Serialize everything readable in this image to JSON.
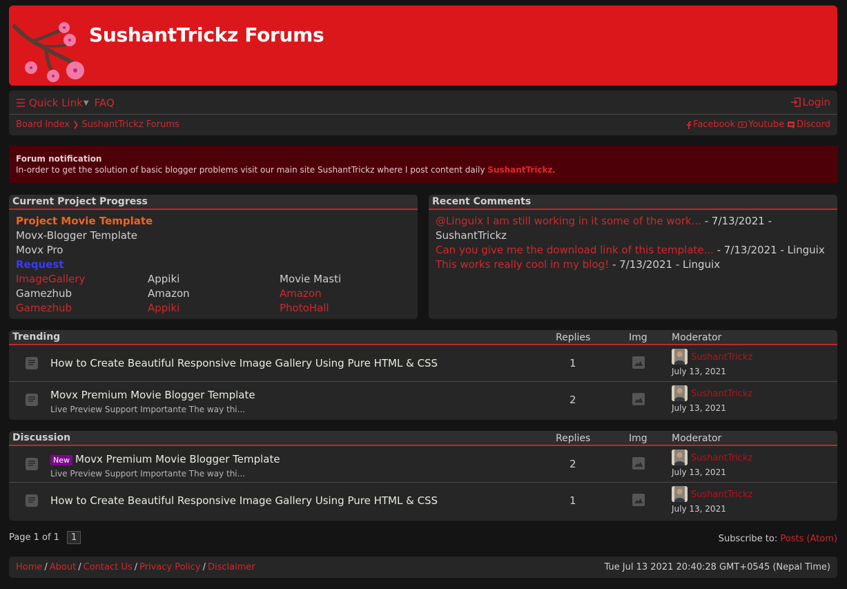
{
  "header": {
    "title": "SushantTrickz Forums",
    "logo_icon": "cherry-blossom-branch"
  },
  "nav": {
    "menu_icon": "hamburger-icon",
    "quick_link": "Quick Link",
    "faq": "FAQ",
    "login": "Login",
    "breadcrumb": [
      "Board Index",
      "SushantTrickz Forums"
    ],
    "social": [
      {
        "label": "Facebook",
        "icon": "facebook-icon"
      },
      {
        "label": "Youtube",
        "icon": "youtube-icon"
      },
      {
        "label": "Discord",
        "icon": "discord-icon"
      }
    ]
  },
  "notification": {
    "title": "Forum notification",
    "body": "In-order to get the solution of basic blogger problems visit our main site SushantTrickz where I post content daily ",
    "link": "SushantTrickz",
    "end": "."
  },
  "project": {
    "title": "Current Project Progress",
    "heading": "Project Movie Template",
    "items": [
      "Movx-Blogger Template",
      "Movx Pro"
    ],
    "request_label": "Request",
    "grid": [
      {
        "text": "ImageGallery",
        "status": "red"
      },
      {
        "text": "Appiki",
        "status": "plain"
      },
      {
        "text": "Movie Masti",
        "status": "plain"
      },
      {
        "text": "Gamezhub",
        "status": "plain"
      },
      {
        "text": "Amazon",
        "status": "plain"
      },
      {
        "text": "Amazon",
        "status": "red"
      },
      {
        "text": "Gamezhub",
        "status": "red"
      },
      {
        "text": "Appiki",
        "status": "red"
      },
      {
        "text": "PhotoHall",
        "status": "red"
      }
    ]
  },
  "comments": {
    "title": "Recent Comments",
    "items": [
      {
        "text": "@Linguix I am still working in it some of the work...",
        "meta": " - 7/13/2021 - SushantTrickz"
      },
      {
        "text": "Can you give me the download link of this template...",
        "meta": " - 7/13/2021 - Linguix"
      },
      {
        "text": "This works really cool in my blog!",
        "meta": " - 7/13/2021 - Linguix"
      }
    ]
  },
  "columns": {
    "replies": "Replies",
    "img": "Img",
    "moderator": "Moderator"
  },
  "trending": {
    "title": "Trending",
    "rows": [
      {
        "title": "How to Create Beautiful Responsive Image Gallery Using Pure HTML & CSS",
        "sub": "",
        "replies": "1",
        "moderator": "SushantTrickz",
        "date": "July 13, 2021",
        "badge": ""
      },
      {
        "title": "Movx Premium Movie Blogger Template",
        "sub": "Live Preview  Support Importante The way thi...",
        "replies": "2",
        "moderator": "SushantTrickz",
        "date": "July 13, 2021",
        "badge": ""
      }
    ]
  },
  "discussion": {
    "title": "Discussion",
    "rows": [
      {
        "title": "Movx Premium Movie Blogger Template",
        "sub": "Live Preview  Support Importante The way thi...",
        "replies": "2",
        "moderator": "SushantTrickz",
        "date": "July 13, 2021",
        "badge": "New"
      },
      {
        "title": "How to Create Beautiful Responsive Image Gallery Using Pure HTML & CSS",
        "sub": "",
        "replies": "1",
        "moderator": "SushantTrickz",
        "date": "July 13, 2021",
        "badge": ""
      }
    ]
  },
  "pager": {
    "label": "Page 1 of 1",
    "current": "1"
  },
  "subscribe": {
    "label": "Subscribe to: ",
    "link": "Posts (Atom)"
  },
  "footer": {
    "links": [
      "Home",
      "About",
      "Contact Us",
      "Privacy Policy",
      "Disclaimer"
    ],
    "separator": "/",
    "time": "Tue Jul 13 2021 20:40:28 GMT+0545 (Nepal Time)"
  },
  "colors": {
    "brand_red": "#dc171c",
    "link_red": "#d3262b",
    "notice_bg": "#4e0009",
    "orange": "#f0641e",
    "blue": "#3a3aff",
    "badge_purple": "#7c0a8c"
  }
}
